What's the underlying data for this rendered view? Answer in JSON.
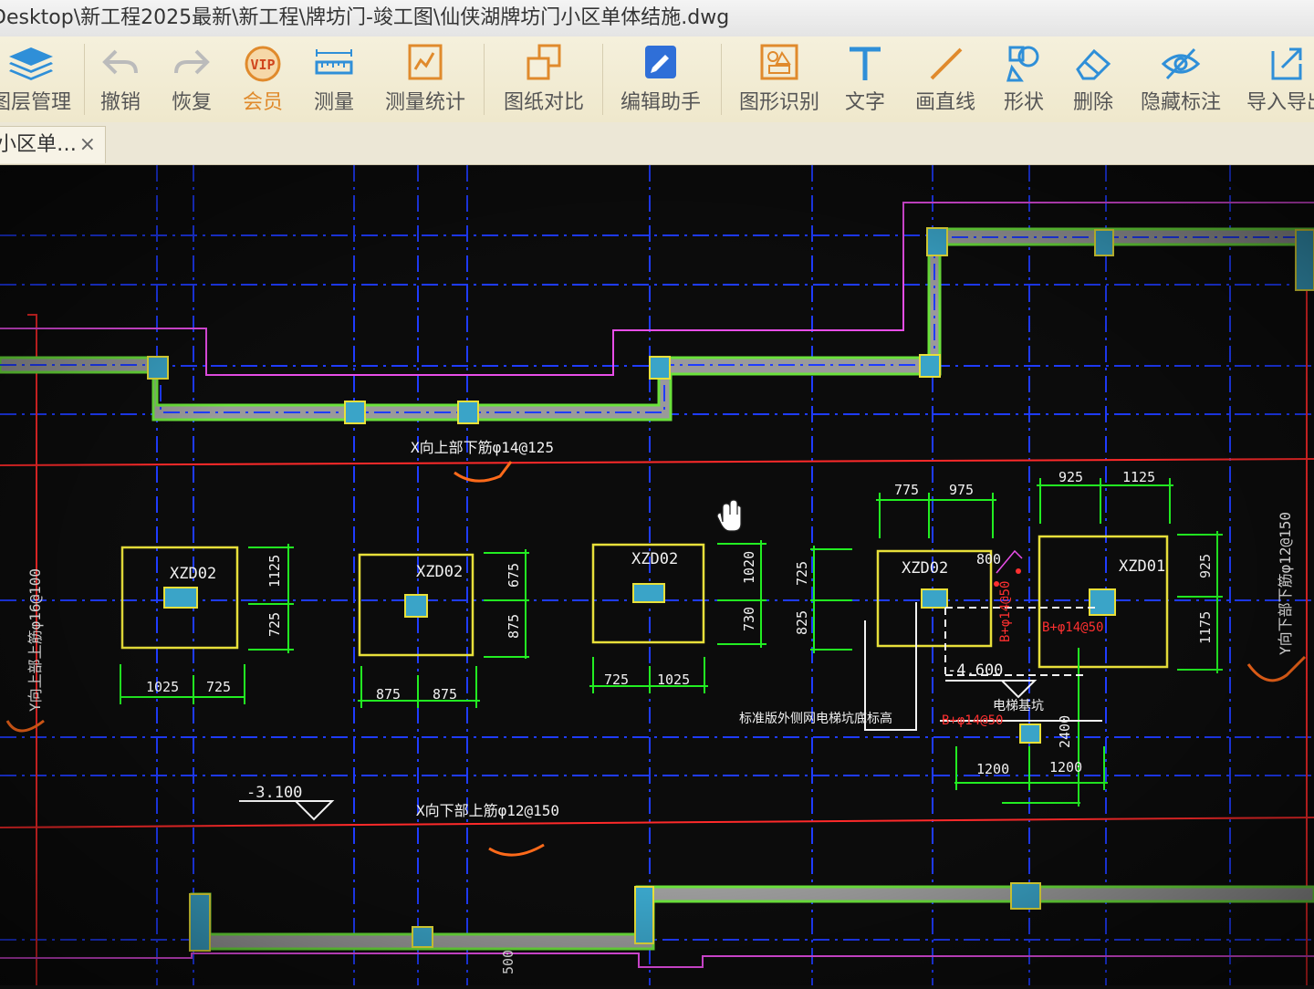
{
  "window": {
    "title": "Desktop\\新工程2025最新\\新工程\\牌坊门-竣工图\\仙侠湖牌坊门小区单体结施.dwg"
  },
  "toolbar": {
    "items": [
      {
        "label": "图层管理",
        "icon": "layers-icon"
      },
      {
        "label": "撤销",
        "icon": "undo-icon"
      },
      {
        "label": "恢复",
        "icon": "redo-icon"
      },
      {
        "label": "会员",
        "icon": "vip-icon"
      },
      {
        "label": "测量",
        "icon": "ruler-icon"
      },
      {
        "label": "测量统计",
        "icon": "measure-stats-icon"
      },
      {
        "label": "图纸对比",
        "icon": "compare-icon"
      },
      {
        "label": "编辑助手",
        "icon": "edit-assistant-icon"
      },
      {
        "label": "图形识别",
        "icon": "shape-recognition-icon"
      },
      {
        "label": "文字",
        "icon": "text-icon"
      },
      {
        "label": "画直线",
        "icon": "line-icon"
      },
      {
        "label": "形状",
        "icon": "shape-icon"
      },
      {
        "label": "删除",
        "icon": "eraser-icon"
      },
      {
        "label": "隐藏标注",
        "icon": "hide-annotation-icon"
      },
      {
        "label": "导入导出",
        "icon": "import-export-icon"
      }
    ],
    "vip_badge": "VIP",
    "colors": {
      "accent_blue": "#2f8fd8",
      "accent_orange": "#e08a2c"
    }
  },
  "tab": {
    "label": "小区单…",
    "close": "×"
  },
  "drawing": {
    "colors": {
      "background": "#0c0c0c",
      "grid": "#1f3cff",
      "wall": "#6be23b",
      "outline": "#e84ee8",
      "footing": "#e8e03a",
      "dim": "#22ee22",
      "axis_red": "#ff2a2a",
      "column_fill": "#3aa4c8",
      "note_red": "#ff3030",
      "sketch": "#ff6a1a"
    },
    "notes": {
      "x_top": "X向上部下筋φ14@125",
      "x_bottom": "X向下部上筋φ12@150",
      "y_left": "Y向上部上筋φ16@100",
      "y_right": "Y向下部下筋φ12@150",
      "elev_left": "-3.100",
      "elev_right": "-4.600",
      "pit_note": "标准版外侧网电梯坑底标高",
      "elevator_pit": "电梯基坑",
      "rebar_1": "B+φ14@50",
      "rebar_2": "B+φ14@50",
      "rebar_3": "B+φ14@50",
      "dim_800": "800",
      "dim_500": "500"
    },
    "footings": [
      {
        "label": "XZD02",
        "dims_h": [
          "1025",
          "725"
        ],
        "dims_v": [
          "1125",
          "725"
        ]
      },
      {
        "label": "XZD02",
        "dims_h": [
          "875",
          "875"
        ],
        "dims_v": [
          "675",
          "875"
        ]
      },
      {
        "label": "XZD02",
        "dims_h": [
          "725",
          "1025"
        ],
        "dims_v": [
          "1020",
          "730"
        ]
      },
      {
        "label": "XZD02",
        "dims_h": [
          "775",
          "975"
        ],
        "dims_v": [
          "725",
          "825"
        ]
      },
      {
        "label": "XZD01",
        "dims_h": [
          "925",
          "1125"
        ],
        "dims_v": [
          "925",
          "1175"
        ]
      }
    ],
    "pit_dims": {
      "width_a": "1200",
      "width_b": "1200",
      "height": "2400"
    }
  }
}
